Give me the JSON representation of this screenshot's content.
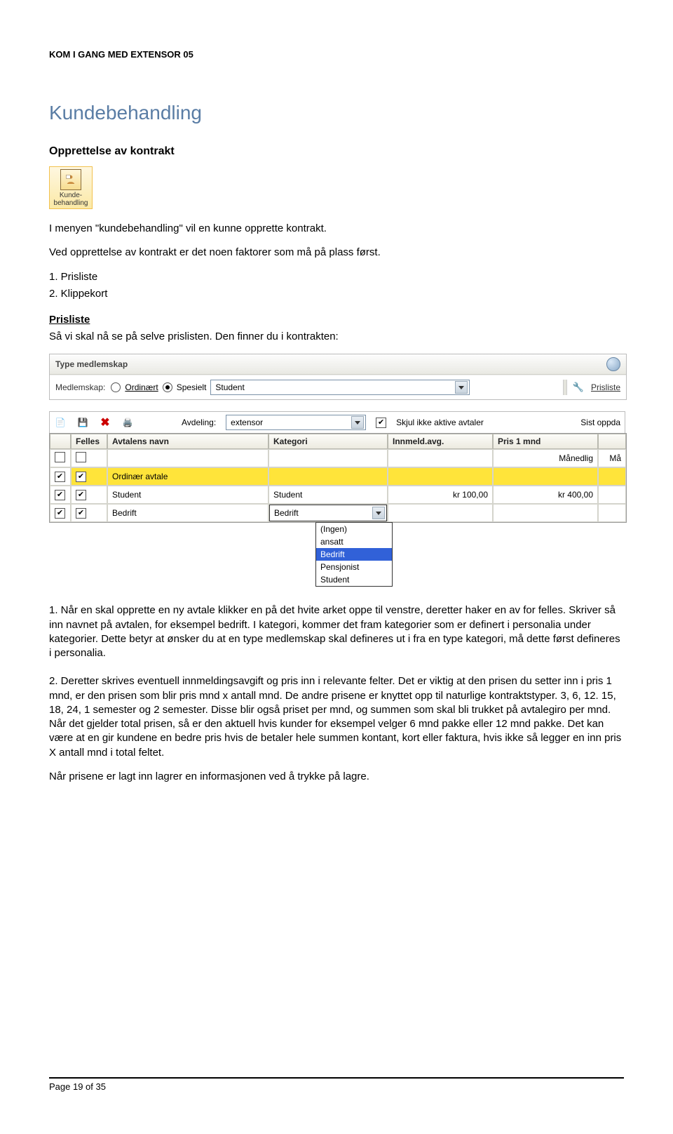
{
  "doc": {
    "header": "KOM I GANG MED EXTENSOR 05"
  },
  "titles": {
    "main": "Kundebehandling",
    "sub": "Opprettelse av kontrakt"
  },
  "shortcut": {
    "label_l1": "Kunde-",
    "label_l2": "behandling"
  },
  "para": {
    "intro1": "I menyen \"kundebehandling\" vil en kunne opprette kontrakt.",
    "intro2": "Ved opprettelse av kontrakt er det noen faktorer som må på plass først.",
    "li1": "1. Prisliste",
    "li2": "2. Klippekort",
    "prisliste_heading": "Prisliste",
    "prisliste_text": "Så vi skal nå se på selve prislisten. Den finner du i kontrakten:",
    "num1": "1. Når en skal opprette en ny avtale klikker en på det hvite arket oppe til venstre, deretter haker en av for felles. Skriver så inn navnet på avtalen, for eksempel bedrift. I kategori, kommer det fram kategorier som er definert i personalia under kategorier. Dette betyr at ønsker du at en type medlemskap skal defineres ut i fra en type kategori, må dette først defineres i personalia.",
    "num2": "2. Deretter skrives eventuell innmeldingsavgift og pris inn i relevante felter. Det er viktig at den prisen du setter inn i pris 1 mnd, er den prisen som blir pris mnd x antall mnd. De andre prisene er knyttet opp til naturlige kontraktstyper. 3, 6, 12. 15, 18, 24, 1 semester og 2 semester.  Disse blir også priset per mnd, og summen som skal bli trukket på avtalegiro per mnd. Når det gjelder total prisen, så er den aktuell hvis kunder for eksempel velger 6 mnd pakke eller 12 mnd pakke. Det kan være at en gir kundene en bedre pris hvis de betaler hele summen kontant, kort eller faktura, hvis ikke så legger en inn pris X antall mnd i total feltet.",
    "final": "Når prisene er lagt inn lagrer en informasjonen ved å trykke på lagre."
  },
  "shot1": {
    "header": "Type medlemskap",
    "medlemskap_label": "Medlemskap:",
    "radio1": "Ordinært",
    "radio2": "Spesielt",
    "select_value": "Student",
    "prisliste_link": "Prisliste"
  },
  "shot2": {
    "avdeling_label": "Avdeling:",
    "avdeling_value": "extensor",
    "skjul_label": "Skjul ikke aktive avtaler",
    "sist_label": "Sist oppda",
    "headers": {
      "c0": "",
      "felles": "Felles",
      "navn": "Avtalens navn",
      "kategori": "Kategori",
      "innmeld": "Innmeld.avg.",
      "pris1": "Pris 1 mnd",
      "last": ""
    },
    "filter_row": {
      "pris1": "Månedlig",
      "last": "Må"
    },
    "rows": [
      {
        "checked": true,
        "felles": true,
        "highlight": true,
        "navn": "Ordinær avtale",
        "kategori": "",
        "innmeld": "",
        "pris1": ""
      },
      {
        "checked": true,
        "felles": true,
        "highlight": false,
        "navn": "Student",
        "kategori": "Student",
        "innmeld": "kr 100,00",
        "pris1": "kr 400,00"
      },
      {
        "checked": true,
        "felles": true,
        "highlight": false,
        "navn": "Bedrift",
        "kategori_select": "Bedrift",
        "innmeld": "",
        "pris1": ""
      }
    ],
    "dropdown": [
      "(Ingen)",
      "ansatt",
      "Bedrift",
      "Pensjonist",
      "Student"
    ],
    "dropdown_selected": "Bedrift"
  },
  "footer": {
    "page": "Page 19 of 35"
  }
}
